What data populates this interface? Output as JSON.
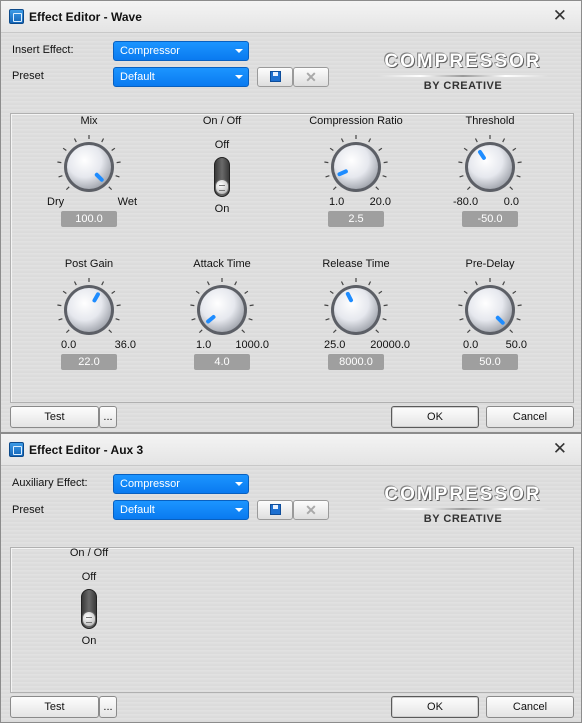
{
  "window1": {
    "title": "Effect Editor - Wave",
    "close_glyph": "✕",
    "effect_label": "Insert Effect:",
    "effect_value": "Compressor",
    "preset_label": "Preset",
    "preset_value": "Default",
    "logo": {
      "main": "COMPRESSOR",
      "sub": "BY CREATIVE"
    },
    "knobs": [
      {
        "title": "Mix",
        "min": "Dry",
        "max": "Wet",
        "value": "100.0",
        "fraction": 1.0
      },
      {
        "title": "Compression Ratio",
        "min": "1.0",
        "max": "20.0",
        "value": "2.5",
        "fraction": 0.08
      },
      {
        "title": "Threshold",
        "min": "-80.0",
        "max": "0.0",
        "value": "-50.0",
        "fraction": 0.375
      },
      {
        "title": "Post Gain",
        "min": "0.0",
        "max": "36.0",
        "value": "22.0",
        "fraction": 0.61
      },
      {
        "title": "Attack Time",
        "min": "1.0",
        "max": "1000.0",
        "value": "4.0",
        "fraction": 0.02
      },
      {
        "title": "Release Time",
        "min": "25.0",
        "max": "20000.0",
        "value": "8000.0",
        "fraction": 0.4
      },
      {
        "title": "Pre-Delay",
        "min": "0.0",
        "max": "50.0",
        "value": "50.0",
        "fraction": 1.0
      }
    ],
    "toggle": {
      "title": "On / Off",
      "off": "Off",
      "on": "On",
      "state": "on"
    },
    "test_label": "Test",
    "more_label": "...",
    "ok_label": "OK",
    "cancel_label": "Cancel"
  },
  "window2": {
    "title": "Effect Editor - Aux 3",
    "close_glyph": "✕",
    "effect_label": "Auxiliary Effect:",
    "effect_value": "Compressor",
    "preset_label": "Preset",
    "preset_value": "Default",
    "logo": {
      "main": "COMPRESSOR",
      "sub": "BY CREATIVE"
    },
    "toggle": {
      "title": "On / Off",
      "off": "Off",
      "on": "On",
      "state": "on"
    },
    "test_label": "Test",
    "more_label": "...",
    "ok_label": "OK",
    "cancel_label": "Cancel"
  },
  "icons": {
    "app": "app-icon",
    "save": "save-icon",
    "delete": "delete-icon",
    "close": "close-icon"
  },
  "colors": {
    "dropdown": "#0a7af0",
    "knob_indicator": "#1e8cff",
    "value_box": "#9f9f9f"
  }
}
